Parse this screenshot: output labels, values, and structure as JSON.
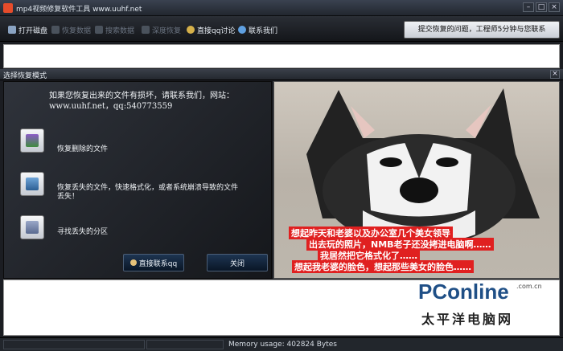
{
  "window": {
    "title": "mp4视频修复软件工具 www.uuhf.net"
  },
  "toolbar": {
    "items": [
      {
        "label": "打开磁盘",
        "enabled": true
      },
      {
        "label": "恢复数据",
        "enabled": false
      },
      {
        "label": "搜索数据",
        "enabled": false
      },
      {
        "label": "深度恢复",
        "enabled": false
      },
      {
        "label": "直接qq讨论",
        "enabled": true
      },
      {
        "label": "联系我们",
        "enabled": true
      }
    ],
    "consult_label": "提交恢复的问题，工程师5分钟与您联系"
  },
  "dialog": {
    "title": "选择恢复模式",
    "intro": "如果您恢复出来的文件有损坏，请联系我们，网站：www.uuhf.net，qq:540773559",
    "options": [
      {
        "label": "恢复删除的文件"
      },
      {
        "label": "恢复丢失的文件，快速格式化，或者系统崩溃导致的文件丢失！"
      },
      {
        "label": "寻找丢失的分区"
      }
    ],
    "contact_button": "直接联系qq",
    "close_button": "关闭"
  },
  "photo": {
    "caption_lines": [
      "想起昨天和老婆以及办公室几个美女领导",
      "出去玩的照片，NMB老子还没拷进电脑啊……",
      "我居然把它格式化了……",
      "想起我老婆的脸色，想起那些美女的脸色……"
    ]
  },
  "statusbar": {
    "memory": "Memory usage: 402824 Bytes"
  },
  "watermark": {
    "brand": "PConline",
    "url": ".com.cn",
    "cn": "太平洋电脑网"
  }
}
